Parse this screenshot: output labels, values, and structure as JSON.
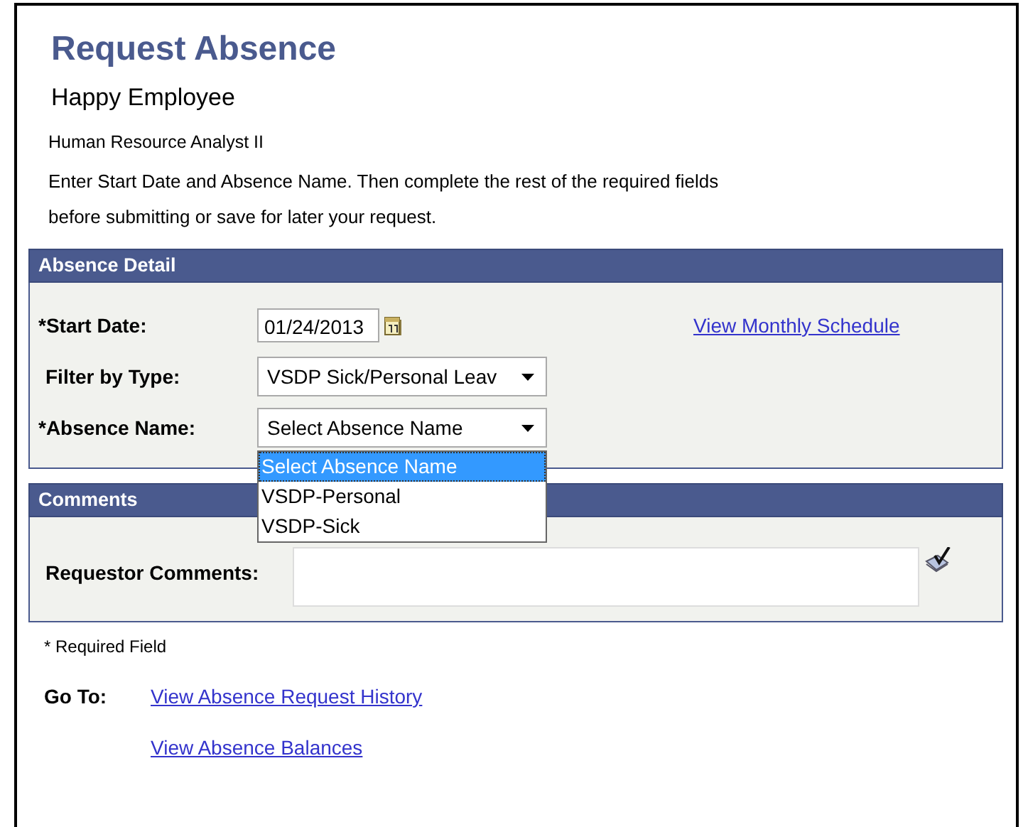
{
  "page": {
    "title": "Request Absence",
    "employee_name": "Happy Employee",
    "job_title": "Human Resource Analyst II",
    "instructions": [
      "Enter Start Date and Absence Name. Then complete the rest of the required fields",
      "before submitting or save for later your request."
    ]
  },
  "absence_detail": {
    "header": "Absence Detail",
    "start_date": {
      "label": "*Start Date:",
      "value": "01/24/2013"
    },
    "schedule_link": "View Monthly Schedule",
    "filter_by_type": {
      "label": "Filter by Type:",
      "value": "VSDP Sick/Personal Leav"
    },
    "absence_name": {
      "label": "*Absence Name:",
      "value": "Select Absence Name",
      "expanded": true,
      "options": [
        {
          "label": "Select Absence Name",
          "selected": true
        },
        {
          "label": "VSDP-Personal",
          "selected": false
        },
        {
          "label": "VSDP-Sick",
          "selected": false
        }
      ]
    }
  },
  "comments": {
    "header": "Comments",
    "requestor_comments": {
      "label": "Requestor Comments:"
    }
  },
  "required_note": "* Required Field",
  "go_to": {
    "label": "Go To:",
    "links": [
      "View Absence Request History",
      "View Absence Balances"
    ]
  }
}
